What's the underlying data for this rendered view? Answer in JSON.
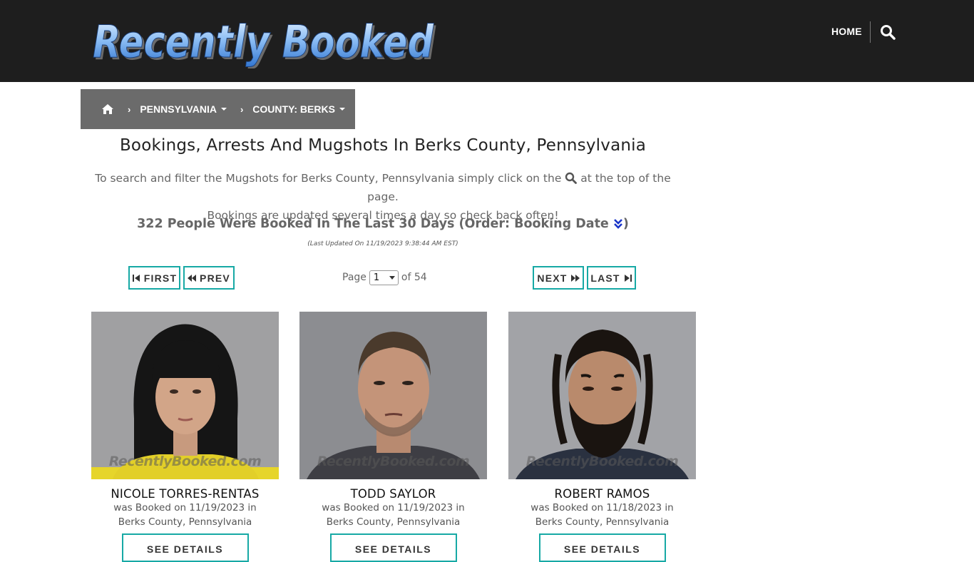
{
  "header": {
    "logo_text": "Recently Booked",
    "nav_home": "HOME",
    "search_icon": "search-icon"
  },
  "breadcrumb": {
    "home_icon": "home-icon",
    "items": [
      {
        "label": "PENNSYLVANIA"
      },
      {
        "label": "COUNTY: BERKS"
      }
    ]
  },
  "main": {
    "title": "Bookings, Arrests And Mugshots In Berks County, Pennsylvania",
    "intro_before_icon": "To search and filter the Mugshots for Berks County, Pennsylvania simply click on the",
    "intro_after_icon": "at the top of the page.",
    "intro_line2": "Bookings are updated several times a day so check back often!",
    "count_text": "322 People Were Booked In The Last 30 Days (Order: Booking Date",
    "count_close": ")",
    "last_updated": "(Last Updated On 11/19/2023 9:38:44 AM EST)"
  },
  "pagination": {
    "first": "FIRST",
    "prev": "PREV",
    "next": "NEXT",
    "last": "LAST",
    "page_label": "Page",
    "current_page": "1",
    "of_label": "of 54"
  },
  "watermark": "RecentlyBooked.com",
  "bookings": [
    {
      "name": "NICOLE TORRES-RENTAS",
      "line1": "was Booked on 11/19/2023 in",
      "line2": "Berks County, Pennsylvania",
      "button": "SEE DETAILS"
    },
    {
      "name": "TODD SAYLOR",
      "line1": "was Booked on 11/19/2023 in",
      "line2": "Berks County, Pennsylvania",
      "button": "SEE DETAILS"
    },
    {
      "name": "ROBERT RAMOS",
      "line1": "was Booked on 11/18/2023 in",
      "line2": "Berks County, Pennsylvania",
      "button": "SEE DETAILS"
    }
  ],
  "colors": {
    "header_bg": "#1e1e1e",
    "breadcrumb_bg": "#6b6b6b",
    "accent_teal": "#17a9a5",
    "logo_blue": "#4a90e2"
  }
}
